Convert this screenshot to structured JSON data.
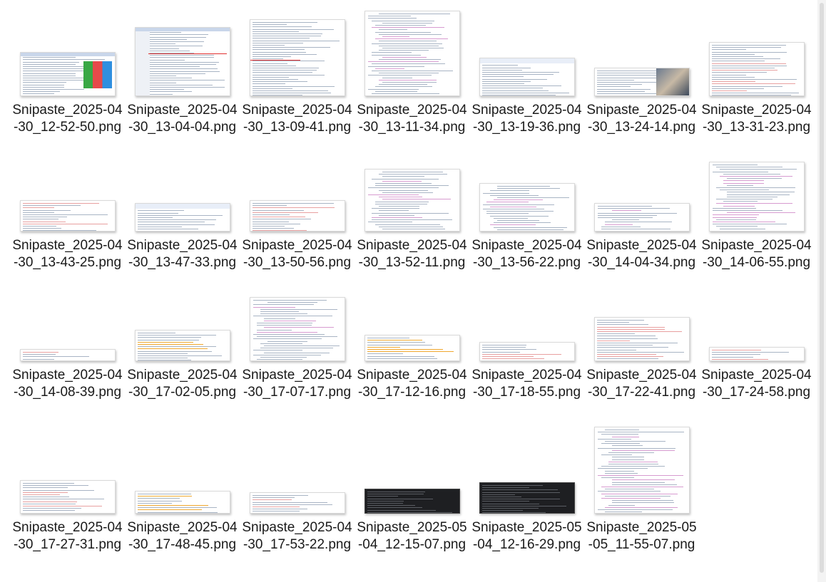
{
  "files": [
    {
      "name": "Snipaste_2025-04-30_12-52-50.png",
      "thumb": {
        "w": 132,
        "h": 60,
        "style": "web"
      }
    },
    {
      "name": "Snipaste_2025-04-30_13-04-04.png",
      "thumb": {
        "w": 132,
        "h": 95,
        "style": "web2"
      }
    },
    {
      "name": "Snipaste_2025-04-30_13-09-41.png",
      "thumb": {
        "w": 132,
        "h": 106,
        "style": "code-annot"
      }
    },
    {
      "name": "Snipaste_2025-04-30_13-11-34.png",
      "thumb": {
        "w": 132,
        "h": 118,
        "style": "code"
      }
    },
    {
      "name": "Snipaste_2025-04-30_13-19-36.png",
      "thumb": {
        "w": 132,
        "h": 52,
        "style": "popup"
      }
    },
    {
      "name": "Snipaste_2025-04-30_13-24-14.png",
      "thumb": {
        "w": 132,
        "h": 38,
        "style": "photo"
      }
    },
    {
      "name": "Snipaste_2025-04-30_13-31-23.png",
      "thumb": {
        "w": 132,
        "h": 74,
        "style": "log"
      }
    },
    {
      "name": "Snipaste_2025-04-30_13-43-25.png",
      "thumb": {
        "w": 132,
        "h": 42,
        "style": "log"
      }
    },
    {
      "name": "Snipaste_2025-04-30_13-47-33.png",
      "thumb": {
        "w": 132,
        "h": 38,
        "style": "popup"
      }
    },
    {
      "name": "Snipaste_2025-04-30_13-50-56.png",
      "thumb": {
        "w": 132,
        "h": 42,
        "style": "log"
      }
    },
    {
      "name": "Snipaste_2025-04-30_13-52-11.png",
      "thumb": {
        "w": 132,
        "h": 86,
        "style": "code"
      }
    },
    {
      "name": "Snipaste_2025-04-30_13-56-22.png",
      "thumb": {
        "w": 132,
        "h": 66,
        "style": "code"
      }
    },
    {
      "name": "Snipaste_2025-04-30_14-04-34.png",
      "thumb": {
        "w": 132,
        "h": 38,
        "style": "code"
      }
    },
    {
      "name": "Snipaste_2025-04-30_14-06-55.png",
      "thumb": {
        "w": 132,
        "h": 96,
        "style": "code"
      }
    },
    {
      "name": "Snipaste_2025-04-30_14-08-39.png",
      "thumb": {
        "w": 132,
        "h": 15,
        "style": "log"
      }
    },
    {
      "name": "Snipaste_2025-04-30_17-02-05.png",
      "thumb": {
        "w": 132,
        "h": 42,
        "style": "orange"
      }
    },
    {
      "name": "Snipaste_2025-04-30_17-07-17.png",
      "thumb": {
        "w": 132,
        "h": 88,
        "style": "code"
      }
    },
    {
      "name": "Snipaste_2025-04-30_17-12-16.png",
      "thumb": {
        "w": 132,
        "h": 35,
        "style": "orange"
      }
    },
    {
      "name": "Snipaste_2025-04-30_17-18-55.png",
      "thumb": {
        "w": 132,
        "h": 25,
        "style": "log"
      }
    },
    {
      "name": "Snipaste_2025-04-30_17-22-41.png",
      "thumb": {
        "w": 132,
        "h": 60,
        "style": "log"
      }
    },
    {
      "name": "Snipaste_2025-04-30_17-24-58.png",
      "thumb": {
        "w": 132,
        "h": 18,
        "style": "log"
      }
    },
    {
      "name": "Snipaste_2025-04-30_17-27-31.png",
      "thumb": {
        "w": 132,
        "h": 45,
        "style": "log"
      }
    },
    {
      "name": "Snipaste_2025-04-30_17-48-45.png",
      "thumb": {
        "w": 132,
        "h": 30,
        "style": "orange"
      }
    },
    {
      "name": "Snipaste_2025-04-30_17-53-22.png",
      "thumb": {
        "w": 132,
        "h": 28,
        "style": "log"
      }
    },
    {
      "name": "Snipaste_2025-05-04_12-15-07.png",
      "thumb": {
        "w": 132,
        "h": 33,
        "style": "dark"
      }
    },
    {
      "name": "Snipaste_2025-05-04_12-16-29.png",
      "thumb": {
        "w": 132,
        "h": 42,
        "style": "dark"
      }
    },
    {
      "name": "Snipaste_2025-05-05_11-55-07.png",
      "thumb": {
        "w": 132,
        "h": 120,
        "style": "code"
      }
    }
  ]
}
